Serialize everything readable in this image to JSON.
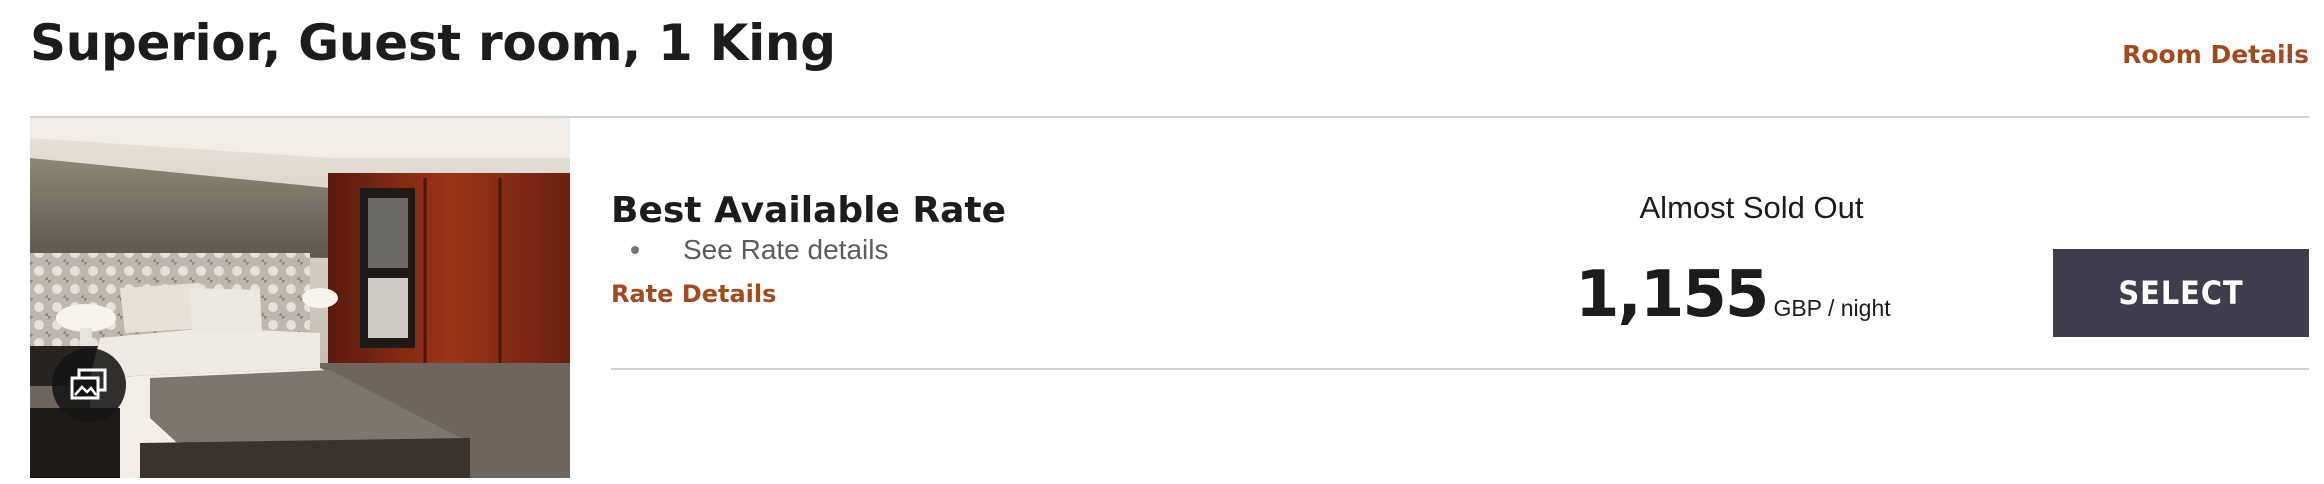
{
  "room": {
    "title": "Superior, Guest room, 1 King",
    "details_link": "Room Details",
    "photo_alt": "Guest room photo",
    "gallery_icon": "gallery-icon"
  },
  "rate": {
    "name": "Best Available Rate",
    "bullets": [
      "See Rate details"
    ],
    "details_link": "Rate Details",
    "availability": "Almost Sold Out",
    "price": "1,155",
    "unit": "GBP / night",
    "select_label": "SELECT"
  },
  "colors": {
    "accent_link": "#a24a1e",
    "select_button": "#3f3d4d",
    "divider": "#d2d2d2"
  }
}
